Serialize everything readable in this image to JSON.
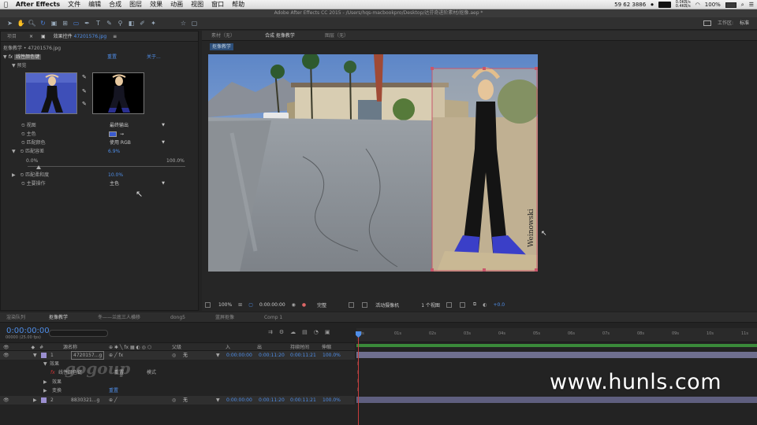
{
  "menubar": {
    "apple": "",
    "app": "After Effects",
    "items": [
      "文件",
      "编辑",
      "合成",
      "图层",
      "效果",
      "动画",
      "视图",
      "窗口",
      "帮助"
    ],
    "status": {
      "phone": "59 62 3886",
      "net_up": "0.0KB/s",
      "net_down": "0.4KB/s",
      "battery": "100%"
    }
  },
  "titlebar": {
    "text": "Adobe After Effects CC 2015 - /Users/hqs-macbookpro/Desktop/达芬奇进阶素材/抠像.aep *"
  },
  "toolbar": {
    "workspace_label": "工作区:",
    "workspace_value": "标准"
  },
  "left_panel": {
    "tab_project": "项目",
    "tab_effects": "效果控件",
    "tab_effects_file": "47201576.jpg",
    "path": "抠像教学 • 47201576.jpg",
    "effect_name": "线性颜色键",
    "reset": "重置",
    "about": "关于...",
    "preview_label": "预览",
    "props": [
      {
        "label": "视图",
        "value": "最终输出"
      },
      {
        "label": "主色",
        "value": ""
      },
      {
        "label": "匹配颜色",
        "value": "使用 RGB"
      },
      {
        "label": "匹配容差",
        "value": "6.9%"
      },
      {
        "label": "匹配柔和度",
        "value": "10.0%"
      },
      {
        "label": "主要操作",
        "value": "主色"
      }
    ],
    "slider_min": "0.0%",
    "slider_max": "100.0%",
    "match_tolerance_level": 0.069,
    "key_color": "#3a5bd0"
  },
  "comp_panel": {
    "tab_footage": "素材（无）",
    "tab_comp": "合成 抠像教学",
    "tab_layer": "图层（无）",
    "comp_name_chip": "抠像教学",
    "signature": "Weinowski",
    "viewer_bar": {
      "zoom": "100%",
      "timecode": "0:00:00:00",
      "quality": "完整",
      "camera": "活动摄像机",
      "views": "1 个视图",
      "exposure": "+0.0"
    }
  },
  "timeline": {
    "tabs": [
      "渲染队列",
      "抠像教学",
      "冬——兰底三人横移",
      "dong5",
      "蓝屏抠像",
      "Comp 1"
    ],
    "timecode": "0:00:00:00",
    "fps": "00000 (25.00 fps)",
    "columns": {
      "source": "源名称",
      "parent": "父级",
      "in": "入",
      "out": "出",
      "duration": "持续时间",
      "stretch": "伸缩"
    },
    "layers": [
      {
        "num": "1",
        "name": "4720157...g",
        "parent": "无",
        "in": "0:00:00:00",
        "out": "0:00:11:20",
        "duration": "0:00:11:21",
        "stretch": "100.0%"
      },
      {
        "num": "2",
        "name": "8830321...g",
        "parent": "无",
        "in": "0:00:00:00",
        "out": "0:00:11:20",
        "duration": "0:00:11:21",
        "stretch": "100.0%"
      }
    ],
    "sub": {
      "effects": "效果",
      "effect_item": "线性颜色键",
      "reset_short": "重置",
      "reset": "重置",
      "transform": "变换",
      "blend": "模式"
    },
    "ruler": [
      "0s",
      "01s",
      "02s",
      "03s",
      "04s",
      "05s",
      "06s",
      "07s",
      "08s",
      "09s",
      "10s",
      "11s"
    ]
  },
  "watermark": {
    "main": "www.hunls.com",
    "faint": "gogoup"
  },
  "colors": {
    "accent": "#4f8ee8",
    "layer_bar": "#6f6f8f",
    "layer_bar2": "#5f5f7f"
  }
}
